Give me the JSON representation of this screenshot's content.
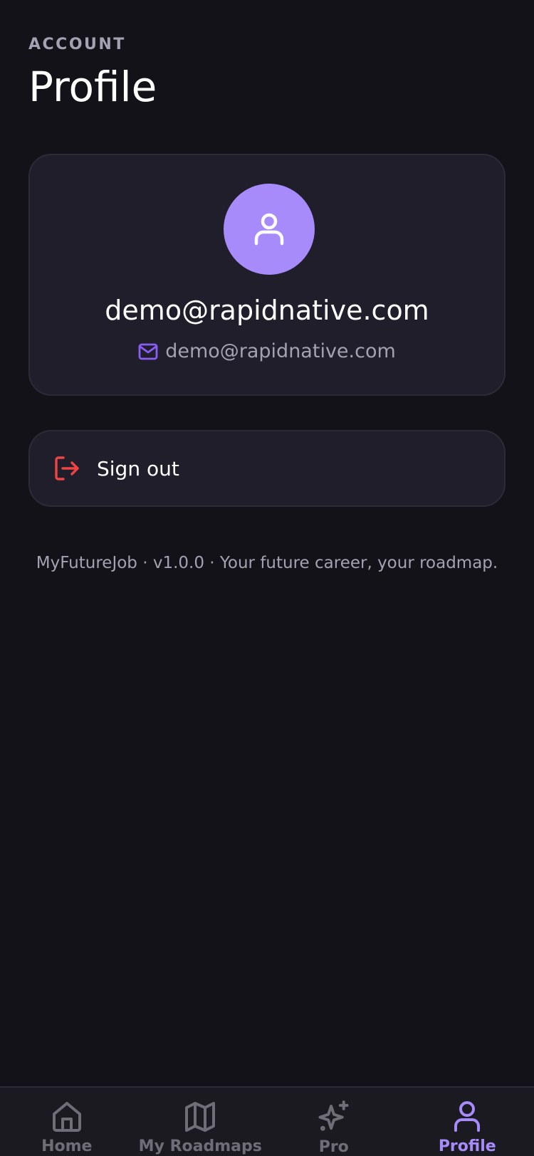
{
  "header": {
    "eyebrow": "ACCOUNT",
    "title": "Profile"
  },
  "profile": {
    "avatar_icon": "user-icon",
    "display_name": "demo@rapidnative.com",
    "email_icon": "mail-icon",
    "email": "demo@rapidnative.com"
  },
  "actions": {
    "signout_icon": "log-out-icon",
    "signout_label": "Sign out"
  },
  "footer": {
    "note": "MyFutureJob · v1.0.0 · Your future career, your roadmap."
  },
  "tabbar": {
    "tabs": [
      {
        "label": "Home",
        "icon": "home-icon",
        "active": false
      },
      {
        "label": "My Roadmaps",
        "icon": "map-icon",
        "active": false
      },
      {
        "label": "Pro",
        "icon": "sparkles-icon",
        "active": false
      },
      {
        "label": "Profile",
        "icon": "user-icon",
        "active": true
      }
    ]
  },
  "colors": {
    "background": "#131218",
    "card": "#1f1e2a",
    "accent": "#a78bfa",
    "danger": "#ef4444",
    "muted": "#a4a2b2",
    "tab_inactive": "#6f6e78"
  }
}
